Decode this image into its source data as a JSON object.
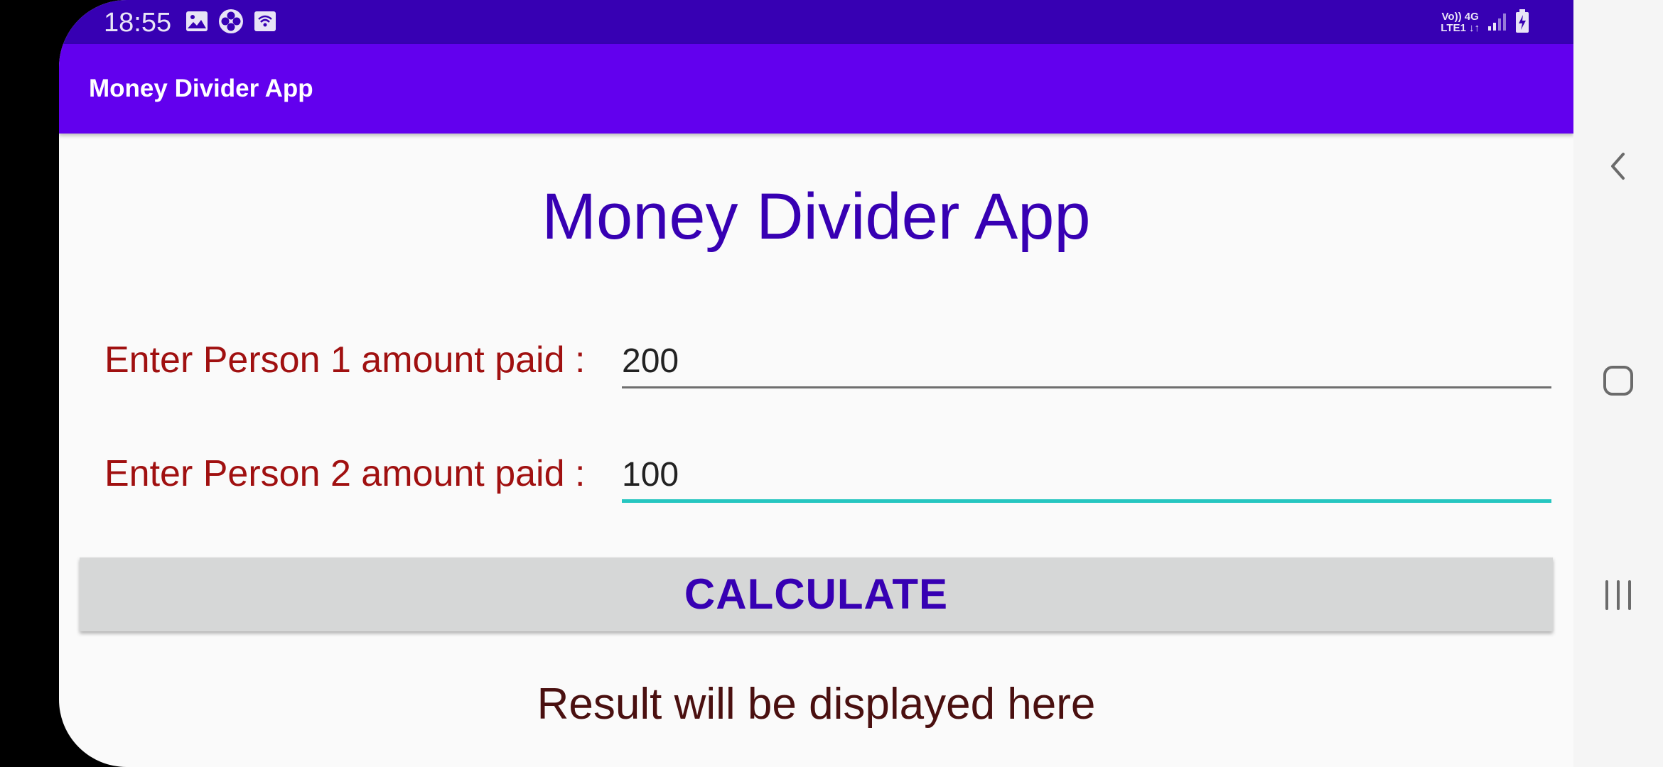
{
  "status_bar": {
    "time": "18:55",
    "network_top": "Vo)) 4G",
    "network_bottom": "LTE1 ↓↑",
    "icons": [
      "image-icon",
      "fan-icon",
      "wifi-call-icon",
      "signal-icon",
      "battery-charging-icon"
    ]
  },
  "app_bar": {
    "title": "Money Divider App"
  },
  "main": {
    "heading": "Money Divider App",
    "person1_label": "Enter Person 1 amount paid :",
    "person1_value": "200",
    "person2_label": "Enter Person 2 amount paid :",
    "person2_value": "100",
    "calculate_label": "CALCULATE",
    "result_text": "Result will be displayed here"
  },
  "nav_bar": {
    "icons": [
      "back-icon",
      "home-icon",
      "recents-icon"
    ]
  },
  "colors": {
    "status_bar": "#3700b3",
    "app_bar": "#6200ee",
    "heading": "#3700b3",
    "label": "#a01010",
    "focus_underline": "#26c6c0",
    "button_bg": "#d6d7d7"
  }
}
